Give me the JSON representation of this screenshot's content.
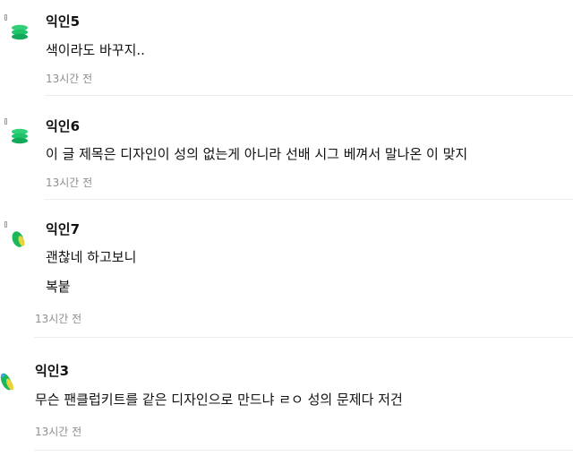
{
  "comments": [
    {
      "author": "익인5",
      "lines": [
        "색이라도 바꾸지.."
      ],
      "time": "13시간 전",
      "avatar_icon": "green-stack-icon",
      "avatar_color": "#1fc46a"
    },
    {
      "author": "익인6",
      "lines": [
        "이 글 제목은 디자인이 성의 없는게 아니라 선배 시그 베껴서 말나온 이 맞지"
      ],
      "time": "13시간 전",
      "avatar_icon": "green-stack-icon",
      "avatar_color": "#1fc46a"
    },
    {
      "author": "익인7",
      "lines": [
        "괜찮네 하고보니",
        "복붙"
      ],
      "time": "13시간 전",
      "avatar_icon": "green-leaf-icon",
      "avatar_color": "#19b85a"
    },
    {
      "author": "익인3",
      "lines": [
        "무슨 팬클럽키트를 같은 디자인으로 만드냐 ㄹㅇ 성의 문제다 저건"
      ],
      "time": "13시간 전",
      "avatar_icon": "green-leaf-icon",
      "avatar_color": "#19b85a"
    }
  ]
}
